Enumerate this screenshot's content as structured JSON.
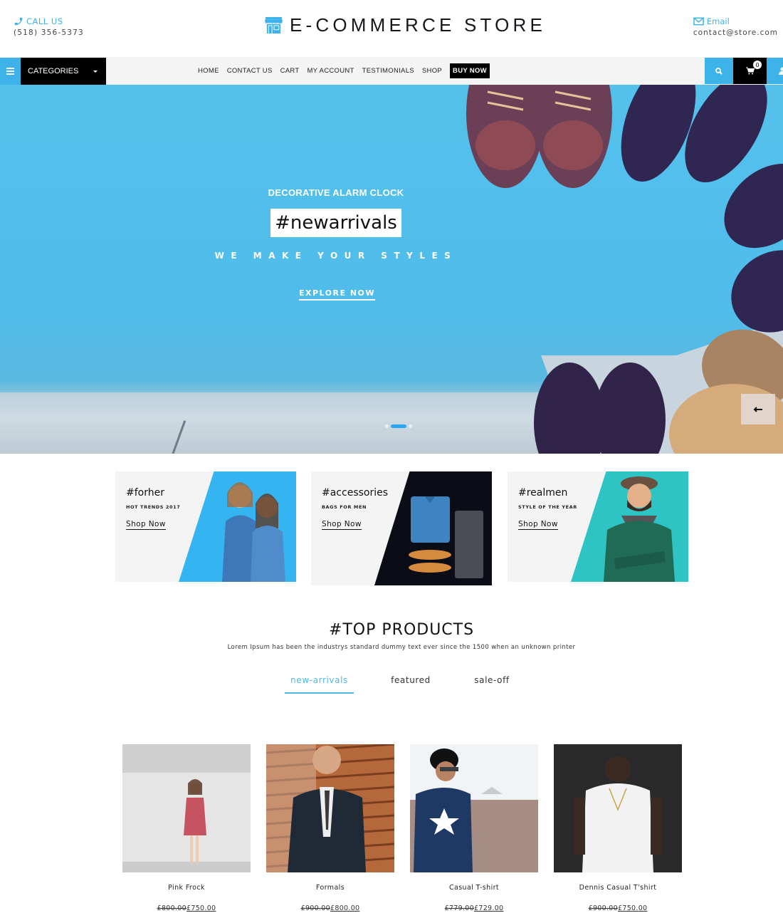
{
  "header": {
    "call_label": "CALL US",
    "phone": "(518) 356-5373",
    "store_name": "E-COMMERCE STORE",
    "email_label": "Email",
    "email": "contact@store.com"
  },
  "nav": {
    "categories_label": "CATEGORIES",
    "menu": [
      "HOME",
      "CONTACT US",
      "CART",
      "MY ACCOUNT",
      "TESTIMONIALS",
      "SHOP"
    ],
    "buy_now": "BUY NOW",
    "cart_count": "0"
  },
  "hero": {
    "subtitle": "DECORATIVE ALARM CLOCK",
    "tag": "#newarrivals",
    "tagline": "WE MAKE YOUR STYLES",
    "cta": "EXPLORE NOW",
    "slides": 3,
    "active_slide": 2
  },
  "promos": [
    {
      "title": "#forher",
      "subtitle": "HOT TRENDS 2017",
      "cta": "Shop Now",
      "color": "#35b4f2"
    },
    {
      "title": "#accessories",
      "subtitle": "BAGS FOR MEN",
      "cta": "Shop Now",
      "color": "#0b0d16"
    },
    {
      "title": "#realmen",
      "subtitle": "STYLE OF THE YEAR",
      "cta": "Shop Now",
      "color": "#2ec4c4"
    }
  ],
  "top_products": {
    "title": "#TOP PRODUCTS",
    "description": "Lorem Ipsum has been the industrys standard dummy text ever since the 1500 when an unknown printer",
    "tabs": [
      "new-arrivals",
      "featured",
      "sale-off"
    ],
    "active_tab": "new-arrivals",
    "items": [
      {
        "name": "Pink Frock",
        "old_price": "£800.00",
        "price": "£750.00"
      },
      {
        "name": "Formals",
        "old_price": "£900.00",
        "price": "£800.00"
      },
      {
        "name": "Casual T-shirt",
        "old_price": "£779.00",
        "price": "£729.00"
      },
      {
        "name": "Dennis Casual T'shirt",
        "old_price": "£900.00",
        "price": "£750.00"
      }
    ]
  },
  "colors": {
    "accent": "#3db3ea",
    "dark": "#000000"
  }
}
